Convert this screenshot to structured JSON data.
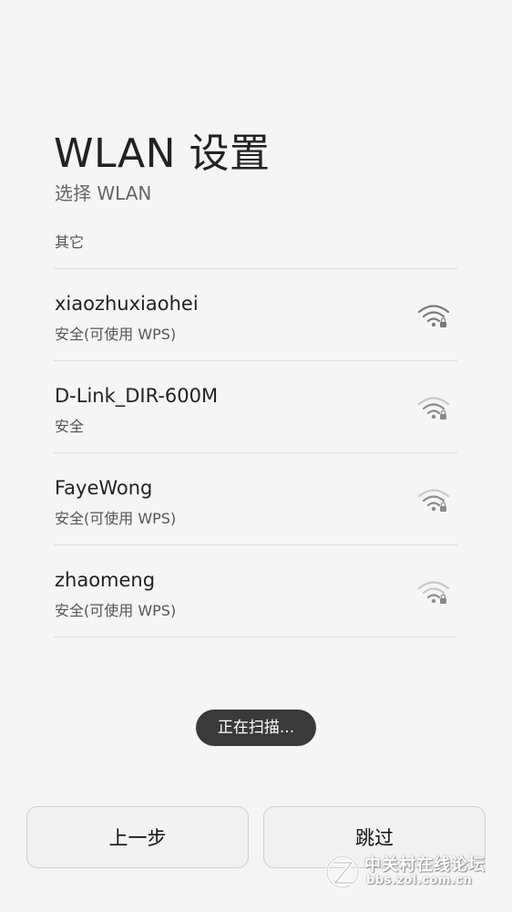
{
  "header": {
    "title": "WLAN 设置",
    "subtitle": "选择 WLAN"
  },
  "networks": [
    {
      "name": "",
      "security": "其它",
      "signal": "strong"
    },
    {
      "name": "xiaozhuxiaohei",
      "security": "安全(可使用 WPS)",
      "signal": "strong"
    },
    {
      "name": "D-Link_DIR-600M",
      "security": "安全",
      "signal": "medium"
    },
    {
      "name": "FayeWong",
      "security": "安全(可使用 WPS)",
      "signal": "medium"
    },
    {
      "name": "zhaomeng",
      "security": "安全(可使用 WPS)",
      "signal": "weak"
    }
  ],
  "toast": {
    "text": "正在扫描..."
  },
  "buttons": {
    "prev_label": "上一步",
    "skip_label": "跳过"
  },
  "watermark": {
    "line1": "中关村在线论坛",
    "line2": "bbs.zol.com.cn"
  },
  "colors": {
    "background": "#f5f5f5",
    "toast_bg": "#3a3a3a",
    "text_primary": "#222222",
    "text_secondary": "#555555",
    "divider": "#dddddd"
  },
  "icons": {
    "wifi": "wifi-lock-icon"
  }
}
